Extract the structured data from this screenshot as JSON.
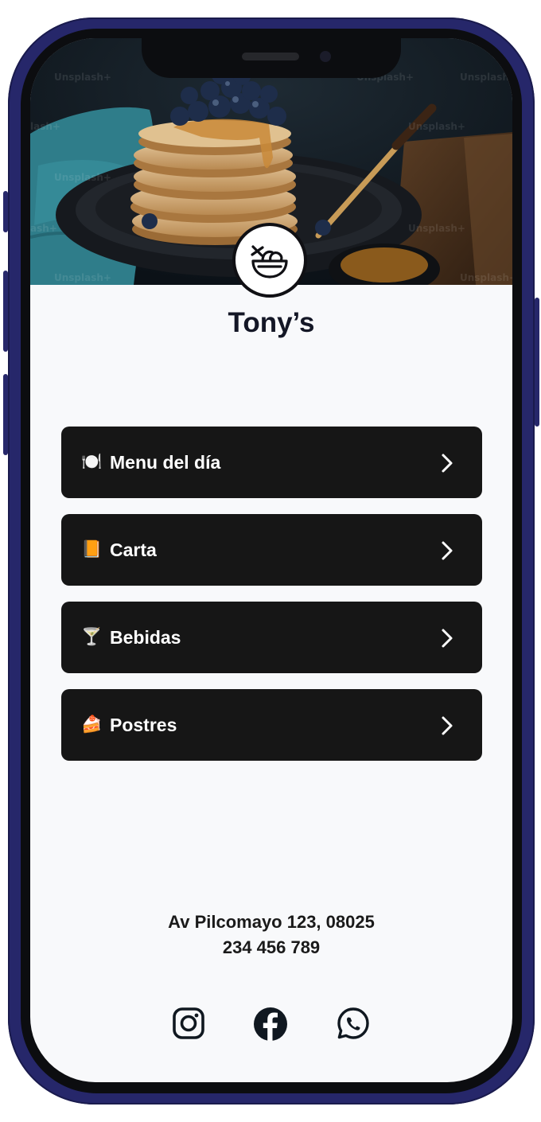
{
  "restaurant": {
    "name": "Tony’s"
  },
  "hero": {
    "watermark": "Unsplash+",
    "watermark_short_1": "lash+",
    "watermark_short_2": "Unsplash",
    "watermark_short_3": "ash+"
  },
  "menu": [
    {
      "emoji": "🍽️",
      "label": "Menu del día"
    },
    {
      "emoji": "📙",
      "label": "Carta"
    },
    {
      "emoji": "🍸",
      "label": "Bebidas"
    },
    {
      "emoji": "🍰",
      "label": "Postres"
    }
  ],
  "contact": {
    "address": "Av Pilcomayo 123, 08025",
    "phone": "234 456 789"
  },
  "social": [
    {
      "icon": "instagram-icon"
    },
    {
      "icon": "facebook-icon"
    },
    {
      "icon": "whatsapp-icon"
    }
  ],
  "colors": {
    "phone_frame": "#26276a",
    "button_bg": "#161616",
    "screen_bg": "#f8f9fb",
    "title": "#141726"
  }
}
